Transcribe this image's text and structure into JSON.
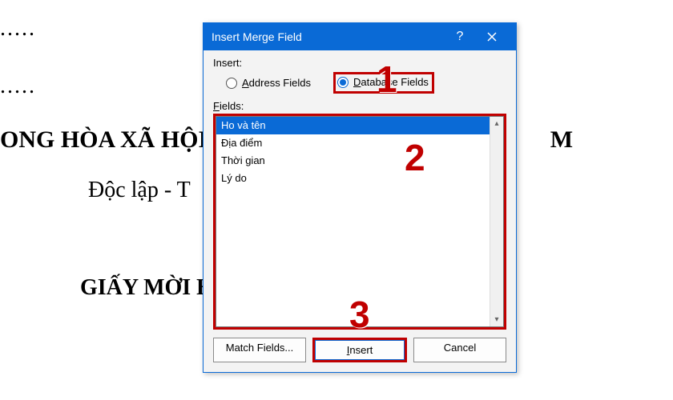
{
  "document": {
    "dots": ".....",
    "line1": "ONG HÒA XÃ HỘI",
    "line1_suffix": "M",
    "line2": "Độc lập - T",
    "line3": "GIẤY MỜI H"
  },
  "dialog": {
    "title": "Insert Merge Field",
    "help_symbol": "?",
    "insert_label": "Insert:",
    "radio_address": "Address Fields",
    "radio_database": "Database Fields",
    "fields_label": "Fields:",
    "items": [
      "Ho và tên",
      "Địa điểm",
      "Thời gian",
      "Lý do"
    ],
    "buttons": {
      "match": "Match Fields...",
      "insert": "Insert",
      "cancel": "Cancel"
    }
  },
  "callouts": {
    "one": "1",
    "two": "2",
    "three": "3"
  }
}
